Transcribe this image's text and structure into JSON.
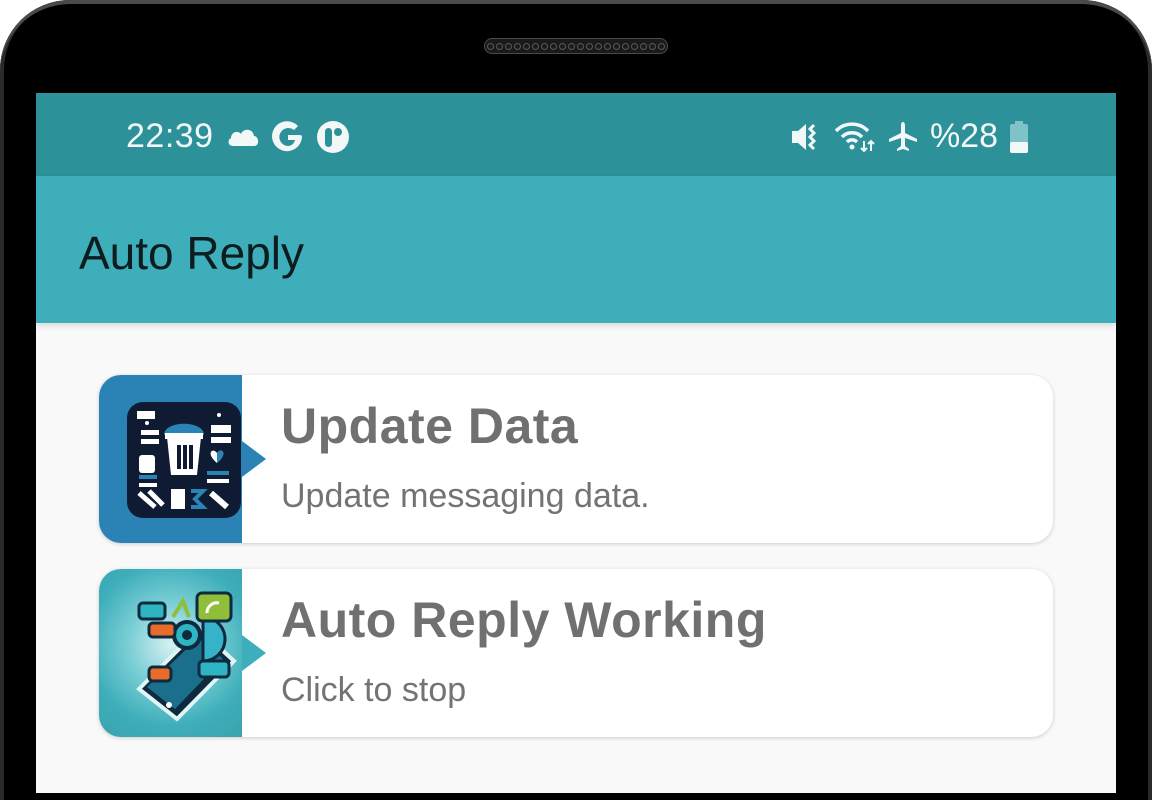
{
  "status_bar": {
    "time": "22:39",
    "left_icons": [
      "cloud-icon",
      "google-icon",
      "app-notification-icon"
    ],
    "right_icons": [
      "vibrate-mute-icon",
      "wifi-icon",
      "airplane-mode-icon"
    ],
    "battery_text": "%28",
    "battery_level": 0.28
  },
  "app_bar": {
    "title": "Auto Reply"
  },
  "cards": [
    {
      "title": "Update Data",
      "subtitle": "Update messaging data.",
      "icon": "trash-cleanup-icon",
      "accent": "#2a83b4"
    },
    {
      "title": "Auto Reply Working",
      "subtitle": "Click to stop",
      "icon": "phone-messages-icon",
      "accent": "#3eaeba"
    }
  ],
  "colors": {
    "status_bar": "#2c9198",
    "app_bar": "#3eaeba",
    "background": "#f9f9f9",
    "card_text": "#707070"
  }
}
